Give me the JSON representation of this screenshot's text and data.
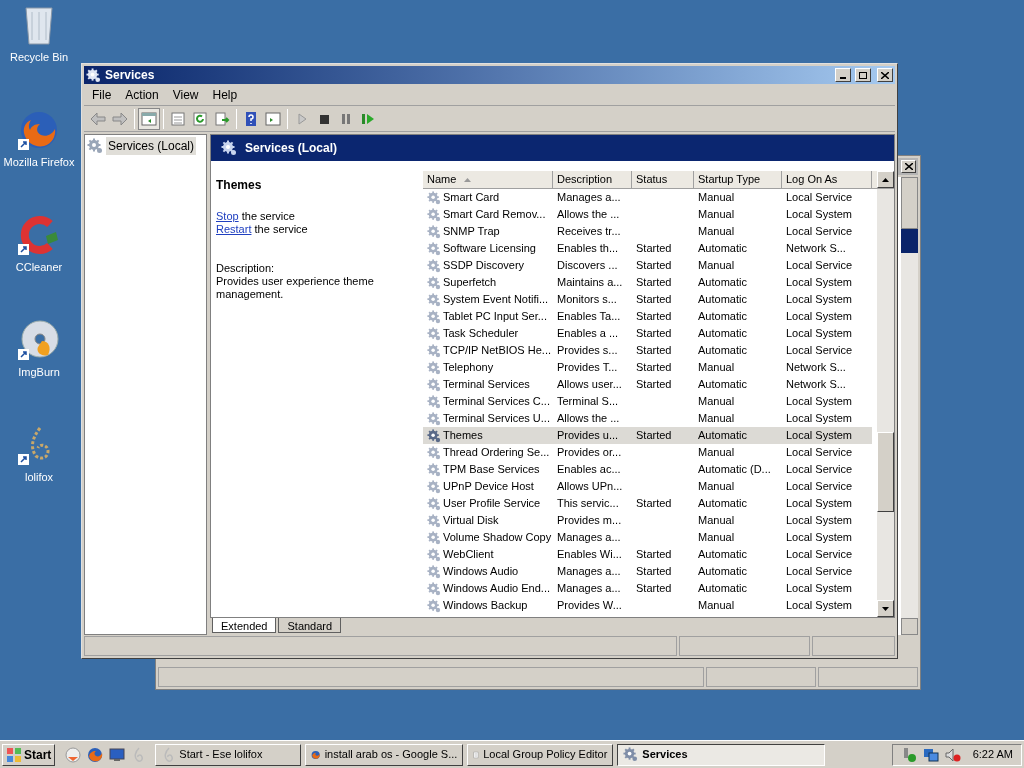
{
  "desktop_icons": [
    {
      "label": "Recycle Bin",
      "kind": "bin"
    },
    {
      "label": "Mozilla Firefox",
      "kind": "firefox"
    },
    {
      "label": "CCleaner",
      "kind": "ccleaner"
    },
    {
      "label": "ImgBurn",
      "kind": "disc"
    },
    {
      "label": "lolifox",
      "kind": "lolifox"
    }
  ],
  "window": {
    "title": "Services"
  },
  "menu": [
    "File",
    "Action",
    "View",
    "Help"
  ],
  "tree": [
    {
      "label": "Services (Local)",
      "selected": true
    }
  ],
  "panel_title": "Services (Local)",
  "details": {
    "name": "Themes",
    "actions": [
      {
        "link": "Stop",
        "text": "the service"
      },
      {
        "link": "Restart",
        "text": "the service"
      }
    ],
    "description_label": "Description:",
    "description": "Provides user experience theme management."
  },
  "table": {
    "columns": [
      "Name",
      "Description",
      "Status",
      "Startup Type",
      "Log On As"
    ],
    "rows": [
      {
        "cells": [
          "Smart Card",
          "Manages a...",
          "",
          "Manual",
          "Local Service"
        ],
        "selected": false
      },
      {
        "cells": [
          "Smart Card Remov...",
          "Allows the ...",
          "",
          "Manual",
          "Local System"
        ],
        "selected": false
      },
      {
        "cells": [
          "SNMP Trap",
          "Receives tr...",
          "",
          "Manual",
          "Local Service"
        ],
        "selected": false
      },
      {
        "cells": [
          "Software Licensing",
          "Enables th...",
          "Started",
          "Automatic",
          "Network S..."
        ],
        "selected": false
      },
      {
        "cells": [
          "SSDP Discovery",
          "Discovers ...",
          "Started",
          "Manual",
          "Local Service"
        ],
        "selected": false
      },
      {
        "cells": [
          "Superfetch",
          "Maintains a...",
          "Started",
          "Automatic",
          "Local System"
        ],
        "selected": false
      },
      {
        "cells": [
          "System Event Notifi...",
          "Monitors s...",
          "Started",
          "Automatic",
          "Local System"
        ],
        "selected": false
      },
      {
        "cells": [
          "Tablet PC Input Ser...",
          "Enables Ta...",
          "Started",
          "Automatic",
          "Local System"
        ],
        "selected": false
      },
      {
        "cells": [
          "Task Scheduler",
          "Enables a ...",
          "Started",
          "Automatic",
          "Local System"
        ],
        "selected": false
      },
      {
        "cells": [
          "TCP/IP NetBIOS He...",
          "Provides s...",
          "Started",
          "Automatic",
          "Local Service"
        ],
        "selected": false
      },
      {
        "cells": [
          "Telephony",
          "Provides T...",
          "Started",
          "Manual",
          "Network S..."
        ],
        "selected": false
      },
      {
        "cells": [
          "Terminal Services",
          "Allows user...",
          "Started",
          "Automatic",
          "Network S..."
        ],
        "selected": false
      },
      {
        "cells": [
          "Terminal Services C...",
          "Terminal S...",
          "",
          "Manual",
          "Local System"
        ],
        "selected": false
      },
      {
        "cells": [
          "Terminal Services U...",
          "Allows the ...",
          "",
          "Manual",
          "Local System"
        ],
        "selected": false
      },
      {
        "cells": [
          "Themes",
          "Provides u...",
          "Started",
          "Automatic",
          "Local System"
        ],
        "selected": true
      },
      {
        "cells": [
          "Thread Ordering Se...",
          "Provides or...",
          "",
          "Manual",
          "Local Service"
        ],
        "selected": false
      },
      {
        "cells": [
          "TPM Base Services",
          "Enables ac...",
          "",
          "Automatic (D...",
          "Local Service"
        ],
        "selected": false
      },
      {
        "cells": [
          "UPnP Device Host",
          "Allows UPn...",
          "",
          "Manual",
          "Local Service"
        ],
        "selected": false
      },
      {
        "cells": [
          "User Profile Service",
          "This servic...",
          "Started",
          "Automatic",
          "Local System"
        ],
        "selected": false
      },
      {
        "cells": [
          "Virtual Disk",
          "Provides m...",
          "",
          "Manual",
          "Local System"
        ],
        "selected": false
      },
      {
        "cells": [
          "Volume Shadow Copy",
          "Manages a...",
          "",
          "Manual",
          "Local System"
        ],
        "selected": false
      },
      {
        "cells": [
          "WebClient",
          "Enables Wi...",
          "Started",
          "Automatic",
          "Local Service"
        ],
        "selected": false
      },
      {
        "cells": [
          "Windows Audio",
          "Manages a...",
          "Started",
          "Automatic",
          "Local Service"
        ],
        "selected": false
      },
      {
        "cells": [
          "Windows Audio End...",
          "Manages a...",
          "Started",
          "Automatic",
          "Local System"
        ],
        "selected": false
      },
      {
        "cells": [
          "Windows Backup",
          "Provides W...",
          "",
          "Manual",
          "Local System"
        ],
        "selected": false
      }
    ]
  },
  "tabs": [
    {
      "label": "Extended",
      "selected": true
    },
    {
      "label": "Standard",
      "selected": false
    }
  ],
  "taskbar": {
    "start": "Start",
    "tasks": [
      {
        "label": "Start - Ese lolifox",
        "kind": "lolifox",
        "selected": false
      },
      {
        "label": "install arab os - Google S...",
        "kind": "firefox",
        "selected": false
      },
      {
        "label": "Local Group Policy Editor",
        "kind": "document",
        "selected": false
      },
      {
        "label": "Services",
        "kind": "gear",
        "selected": true
      }
    ],
    "clock": "6:22 AM"
  }
}
